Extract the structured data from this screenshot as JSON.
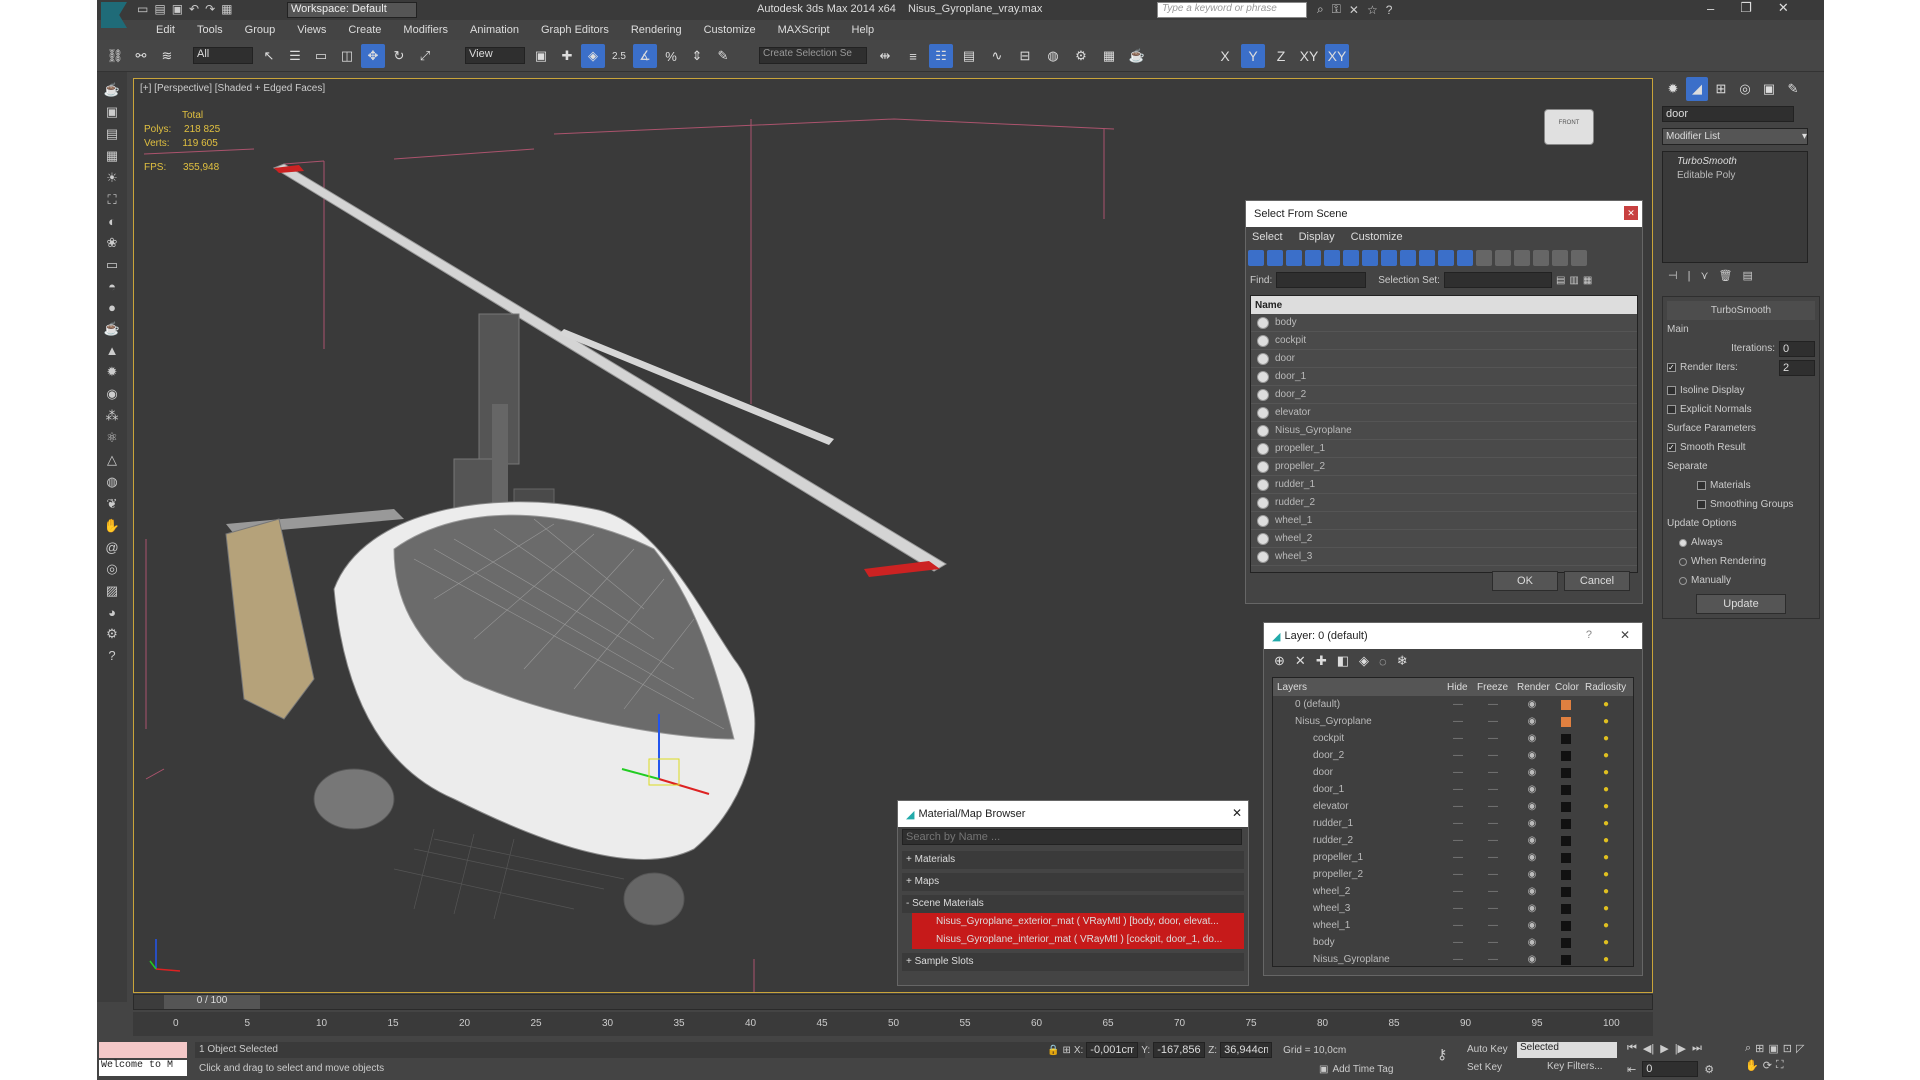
{
  "title": {
    "app": "Autodesk 3ds Max  2014 x64",
    "file": "Nisus_Gyroplane_vray.max",
    "workspace": "Workspace: Default",
    "search_placeholder": "Type a keyword or phrase"
  },
  "menu": [
    "Edit",
    "Tools",
    "Group",
    "Views",
    "Create",
    "Modifiers",
    "Animation",
    "Graph Editors",
    "Rendering",
    "Customize",
    "MAXScript",
    "Help"
  ],
  "toolbar": {
    "filter": "All",
    "ref": "View",
    "selset": "Create Selection Se",
    "axes": [
      "X",
      "Y",
      "Z",
      "XY",
      "XY"
    ],
    "snap": "2.5",
    "pct": "%"
  },
  "viewport": {
    "label": "[+] [Perspective] [Shaded + Edged Faces]",
    "stats_total": "Total",
    "polys_label": "Polys:",
    "polys": "218 825",
    "verts_label": "Verts:",
    "verts": "119 605",
    "fps_label": "FPS:",
    "fps": "355,948",
    "viewcube": "FRONT"
  },
  "command_panel": {
    "search": "door",
    "modifier_list": "Modifier List",
    "stack": [
      "TurboSmooth",
      "Editable Poly"
    ],
    "rollout": "TurboSmooth",
    "main": "Main",
    "iterations_label": "Iterations:",
    "iterations": "0",
    "render_iters_label": "Render Iters:",
    "render_iters": "2",
    "isoline": "Isoline Display",
    "explicit": "Explicit Normals",
    "surface": "Surface Parameters",
    "smooth": "Smooth Result",
    "separate": "Separate",
    "materials": "Materials",
    "smoothing": "Smoothing Groups",
    "update_options": "Update Options",
    "always": "Always",
    "when_rendering": "When Rendering",
    "manually": "Manually",
    "update": "Update"
  },
  "select_scene": {
    "title": "Select From Scene",
    "menu": [
      "Select",
      "Display",
      "Customize"
    ],
    "find": "Find:",
    "selection_set": "Selection Set:",
    "name_col": "Name",
    "items": [
      "body",
      "cockpit",
      "door",
      "door_1",
      "door_2",
      "elevator",
      "Nisus_Gyroplane",
      "propeller_1",
      "propeller_2",
      "rudder_1",
      "rudder_2",
      "wheel_1",
      "wheel_2",
      "wheel_3"
    ],
    "ok": "OK",
    "cancel": "Cancel"
  },
  "layers": {
    "title": "Layer: 0 (default)",
    "help": "?",
    "cols": [
      "Layers",
      "Hide",
      "Freeze",
      "Render",
      "Color",
      "Radiosity"
    ],
    "items": [
      "0 (default)",
      "Nisus_Gyroplane",
      "cockpit",
      "door_2",
      "door",
      "door_1",
      "elevator",
      "rudder_1",
      "rudder_2",
      "propeller_1",
      "propeller_2",
      "wheel_2",
      "wheel_3",
      "wheel_1",
      "body",
      "Nisus_Gyroplane"
    ]
  },
  "material_browser": {
    "title": "Material/Map Browser",
    "search": "Search by Name ...",
    "materials": "+ Materials",
    "maps": "+ Maps",
    "scene_materials": "- Scene Materials",
    "mat1": "Nisus_Gyroplane_exterior_mat ( VRayMtl ) [body, door, elevat...",
    "mat2": "Nisus_Gyroplane_interior_mat ( VRayMtl ) [cockpit, door_1, do...",
    "sample": "+ Sample Slots"
  },
  "timeline": {
    "frame": "0 / 100",
    "ticks": [
      "0",
      "5",
      "10",
      "15",
      "20",
      "25",
      "30",
      "35",
      "40",
      "45",
      "50",
      "55",
      "60",
      "65",
      "70",
      "75",
      "80",
      "85",
      "90",
      "95",
      "100"
    ]
  },
  "status": {
    "welcome": "Welcome to M",
    "selected": "1 Object Selected",
    "prompt": "Click and drag to select and move objects",
    "x_label": "X:",
    "x": "-0,001cm",
    "y_label": "Y:",
    "y": "-167,856cr",
    "z_label": "Z:",
    "z": "36,944cm",
    "grid": "Grid = 10,0cm",
    "add_time_tag": "Add Time Tag",
    "auto_key": "Auto Key",
    "set_key": "Set Key",
    "key_mode": "Selected",
    "key_filters": "Key Filters...",
    "frame": "0"
  }
}
